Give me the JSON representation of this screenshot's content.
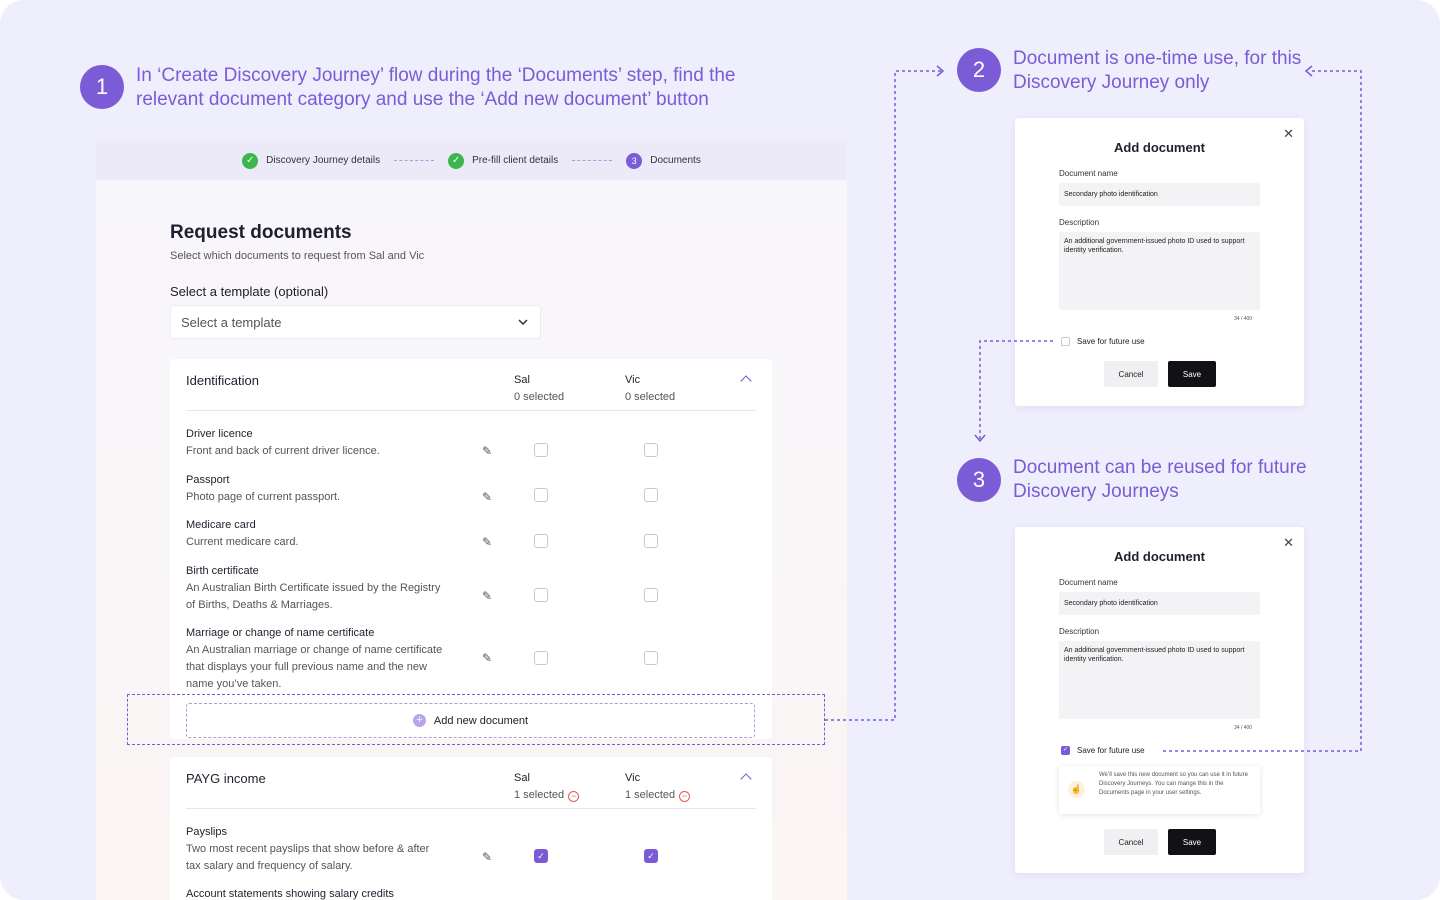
{
  "callouts": {
    "step1": {
      "number": "1",
      "text": "In ‘Create Discovery Journey’ flow during the ‘Documents’ step, find the relevant document category and use the ‘Add new document’ button"
    },
    "step2": {
      "number": "2",
      "text": "Document is one-time use, for this Discovery Journey only"
    },
    "step3": {
      "number": "3",
      "text": "Document can be reused for future Discovery Journeys"
    }
  },
  "stepper": {
    "steps": [
      {
        "label": "Discovery Journey details",
        "state": "done"
      },
      {
        "label": "Pre-fill client details",
        "state": "done"
      },
      {
        "label": "Documents",
        "state": "current",
        "number": "3"
      }
    ]
  },
  "page": {
    "title": "Request documents",
    "subtitle": "Select which documents to request from Sal and Vic",
    "template_label": "Select a template (optional)",
    "template_placeholder": "Select a template"
  },
  "identification": {
    "title": "Identification",
    "col1": {
      "name": "Sal",
      "count": "0 selected"
    },
    "col2": {
      "name": "Vic",
      "count": "0 selected"
    },
    "rows": [
      {
        "name": "Driver licence",
        "desc": "Front and back of current driver licence."
      },
      {
        "name": "Passport",
        "desc": "Photo page of current passport."
      },
      {
        "name": "Medicare card",
        "desc": "Current medicare card."
      },
      {
        "name": "Birth certificate",
        "desc": "An Australian Birth Certificate issued by the Registry of Births, Deaths & Marriages."
      },
      {
        "name": "Marriage or change of name certificate",
        "desc": "An Australian marriage or change of name certificate that displays your full previous name and the new name you’ve taken."
      }
    ],
    "add_label": "Add new document"
  },
  "payg": {
    "title": "PAYG income",
    "col1": {
      "name": "Sal",
      "count": "1 selected"
    },
    "col2": {
      "name": "Vic",
      "count": "1 selected"
    },
    "rows": [
      {
        "name": "Payslips",
        "desc": "Two most recent payslips that show before & after tax salary and frequency of salary.",
        "sal": true,
        "vic": true
      },
      {
        "name": "Account statements showing salary credits",
        "desc": ""
      }
    ]
  },
  "dialog1": {
    "title": "Add document",
    "name_label": "Document name",
    "name_value": "Secondary photo identification",
    "desc_label": "Description",
    "desc_value": "An additional government-issued photo ID used to support identity verification.",
    "counter": "34 / 400",
    "save_future_label": "Save for future use",
    "save_future_checked": false,
    "cancel_label": "Cancel",
    "save_label": "Save"
  },
  "dialog2": {
    "title": "Add document",
    "name_label": "Document name",
    "name_value": "Secondary photo identification",
    "desc_label": "Description",
    "desc_value": "An additional government-issued photo ID used to support identity verification.",
    "counter": "34 / 400",
    "save_future_label": "Save for future use",
    "save_future_checked": true,
    "info_text": "We’ll save this new document so you can use it in future Discovery Journeys. You can mange this in the Documents page in your user settings.",
    "cancel_label": "Cancel",
    "save_label": "Save"
  },
  "colors": {
    "accent": "#7b5bd6",
    "success": "#3db64e",
    "danger": "#e05a5a",
    "background": "#eeeefc"
  }
}
